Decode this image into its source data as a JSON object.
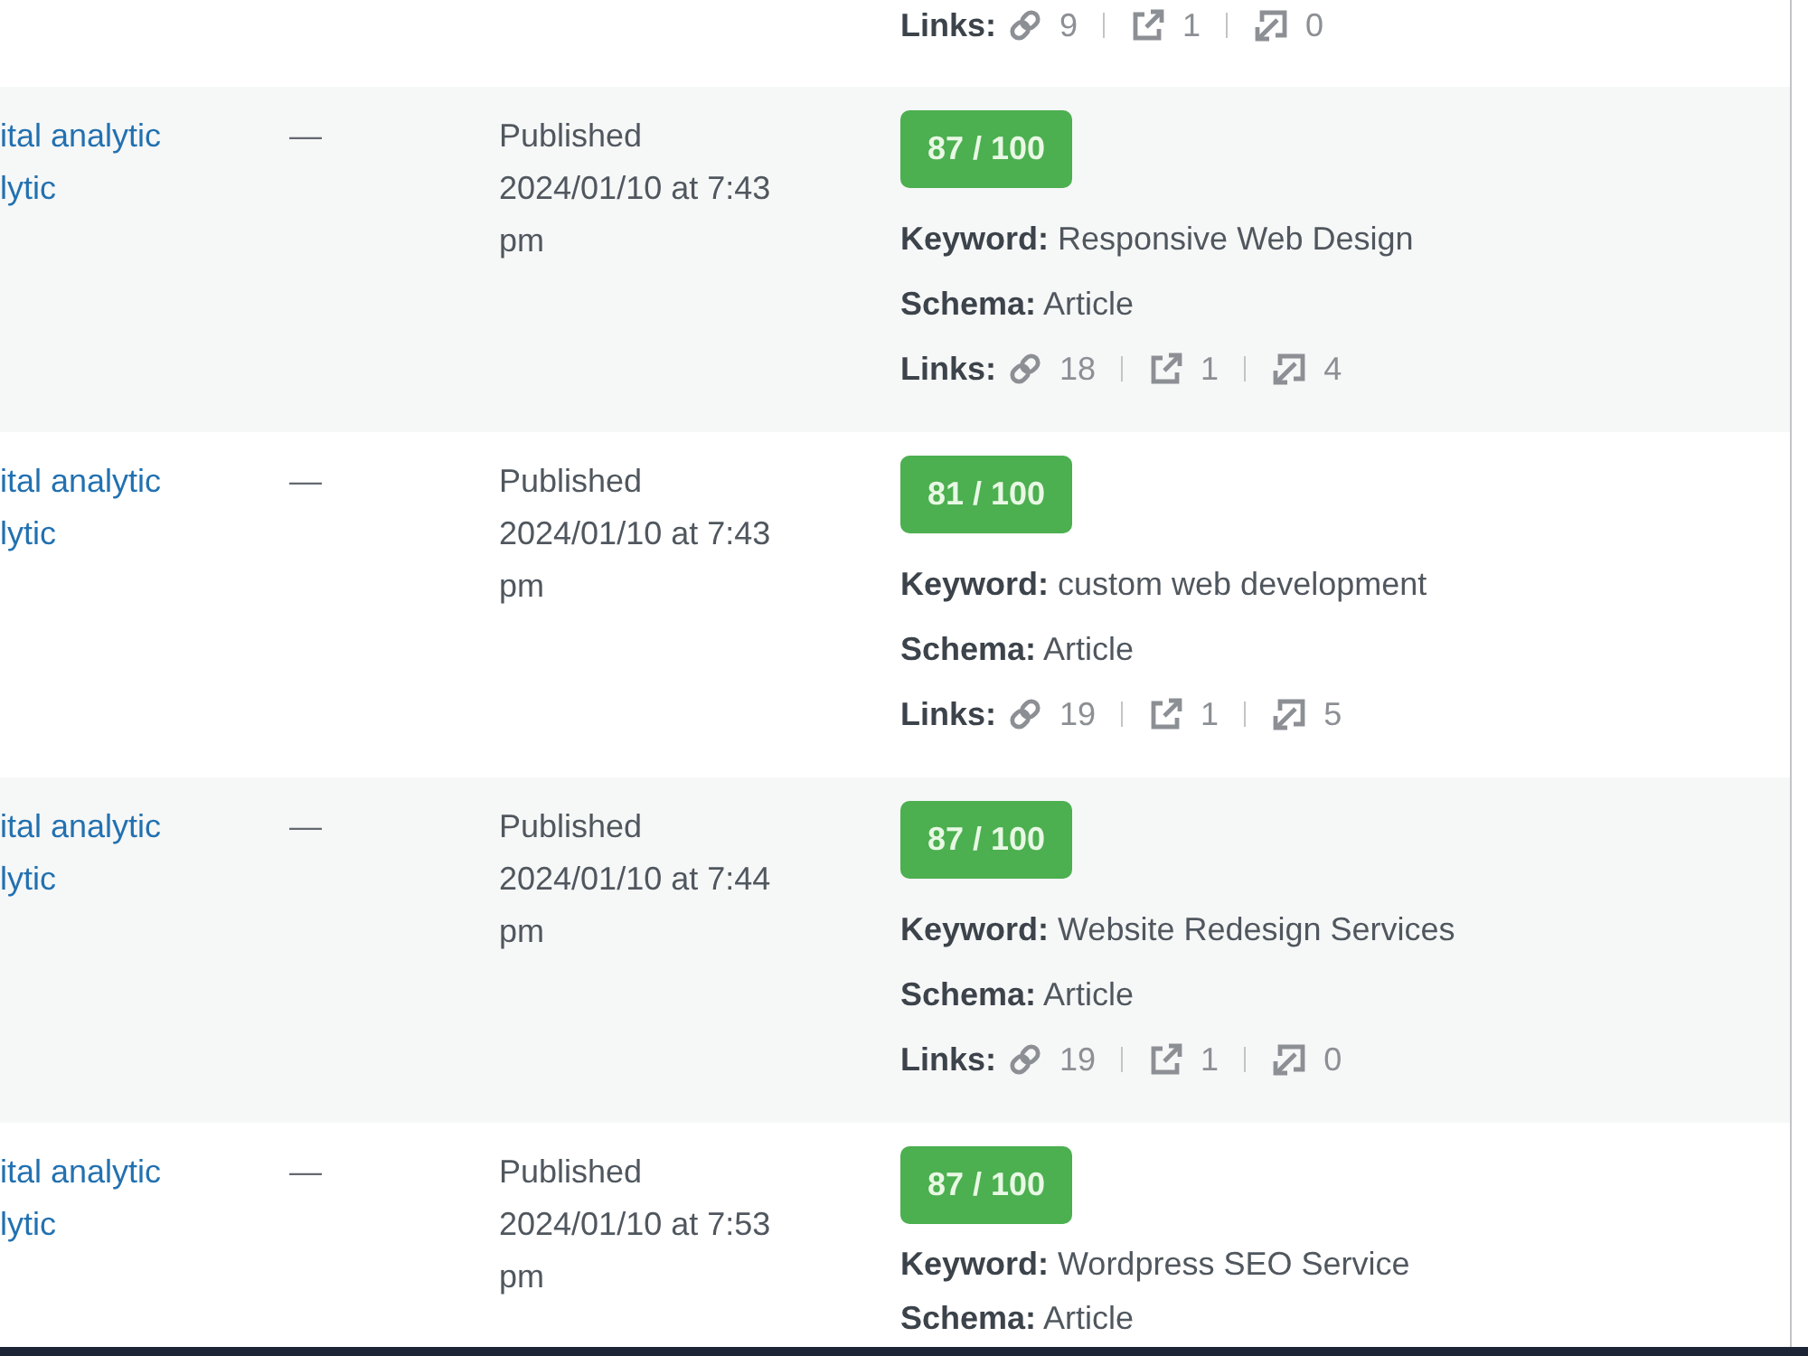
{
  "posts_table": {
    "rows": [
      {
        "links": {
          "label": "Links:",
          "internal": "9",
          "external": "1",
          "incoming": "0"
        }
      },
      {
        "column_1": [
          "ital analytic",
          "lytic"
        ],
        "column_2": "—",
        "status": "Published",
        "date": "2024/01/10 at 7:43 pm",
        "seo_score": "87 / 100",
        "keyword": "**Keyword:** Responsive Web Design",
        "schema": "**Schema:** Article",
        "links": {
          "label": "Links:",
          "internal": "18",
          "external": "1",
          "incoming": "4"
        }
      },
      {
        "column_1": [
          "ital analytic",
          "lytic"
        ],
        "column_2": "—",
        "status": "Published",
        "date": "2024/01/10 at 7:43 pm",
        "seo_score": "81 / 100",
        "keyword": "**Keyword:** custom web development",
        "schema": "**Schema:** Article",
        "links": {
          "label": "Links:",
          "internal": "19",
          "external": "1",
          "incoming": "5"
        }
      },
      {
        "column_1": [
          "ital analytic",
          "lytic"
        ],
        "column_2": "—",
        "status": "Published",
        "date": "2024/01/10 at 7:44 pm",
        "seo_score": "87 / 100",
        "keyword": "**Keyword:** Website Redesign Services",
        "schema": "**Schema:** Article",
        "links": {
          "label": "Links:",
          "internal": "19",
          "external": "1",
          "incoming": "0"
        }
      },
      {
        "column_1": [
          "ital analytic",
          "lytic"
        ],
        "column_2": "—",
        "status": "Published",
        "date": "2024/01/10 at 7:53 pm",
        "seo_score": "87 / 100",
        "keyword": "**Keyword:** Wordpress SEO Service",
        "schema": "**Schema:** Article"
      }
    ]
  }
}
